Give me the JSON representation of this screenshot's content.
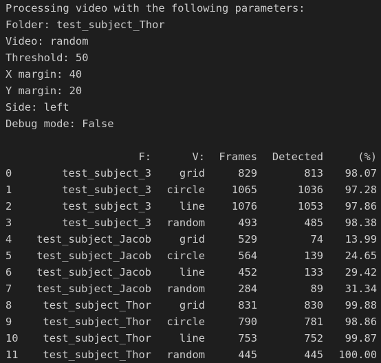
{
  "output_lines": [
    "Processing video with the following parameters:",
    "Folder: test_subject_Thor",
    "Video: random",
    "Threshold: 50",
    "X margin: 40",
    "Y margin: 20",
    "Side: left",
    "Debug mode: False"
  ],
  "table": {
    "headers": {
      "index": "",
      "f": "F:",
      "v": "V:",
      "frames": "Frames",
      "detected": "Detected",
      "pct": "(%)"
    },
    "rows": [
      {
        "index": "0",
        "f": "test_subject_3",
        "v": "grid",
        "frames": "829",
        "detected": "813",
        "pct": "98.07"
      },
      {
        "index": "1",
        "f": "test_subject_3",
        "v": "circle",
        "frames": "1065",
        "detected": "1036",
        "pct": "97.28"
      },
      {
        "index": "2",
        "f": "test_subject_3",
        "v": "line",
        "frames": "1076",
        "detected": "1053",
        "pct": "97.86"
      },
      {
        "index": "3",
        "f": "test_subject_3",
        "v": "random",
        "frames": "493",
        "detected": "485",
        "pct": "98.38"
      },
      {
        "index": "4",
        "f": "test_subject_Jacob",
        "v": "grid",
        "frames": "529",
        "detected": "74",
        "pct": "13.99"
      },
      {
        "index": "5",
        "f": "test_subject_Jacob",
        "v": "circle",
        "frames": "564",
        "detected": "139",
        "pct": "24.65"
      },
      {
        "index": "6",
        "f": "test_subject_Jacob",
        "v": "line",
        "frames": "452",
        "detected": "133",
        "pct": "29.42"
      },
      {
        "index": "7",
        "f": "test_subject_Jacob",
        "v": "random",
        "frames": "284",
        "detected": "89",
        "pct": "31.34"
      },
      {
        "index": "8",
        "f": "test_subject_Thor",
        "v": "grid",
        "frames": "831",
        "detected": "830",
        "pct": "99.88"
      },
      {
        "index": "9",
        "f": "test_subject_Thor",
        "v": "circle",
        "frames": "790",
        "detected": "781",
        "pct": "98.86"
      },
      {
        "index": "10",
        "f": "test_subject_Thor",
        "v": "line",
        "frames": "753",
        "detected": "752",
        "pct": "99.87"
      },
      {
        "index": "11",
        "f": "test_subject_Thor",
        "v": "random",
        "frames": "445",
        "detected": "445",
        "pct": "100.00"
      }
    ]
  }
}
